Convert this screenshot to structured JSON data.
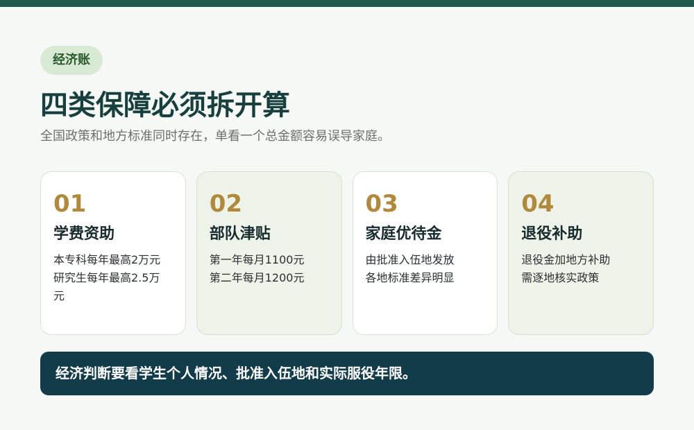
{
  "header": {
    "pill": "经济账",
    "title": "四类保障必须拆开算",
    "subtitle": "全国政策和地方标准同时存在，单看一个总金额容易误导家庭。"
  },
  "cards": [
    {
      "num": "01",
      "title": "学费资助",
      "lines": [
        "本专科每年最高2万元",
        "研究生每年最高2.5万",
        "元"
      ]
    },
    {
      "num": "02",
      "title": "部队津贴",
      "lines": [
        "第一年每月1100元",
        "第二年每月1200元"
      ]
    },
    {
      "num": "03",
      "title": "家庭优待金",
      "lines": [
        "由批准入伍地发放",
        "各地标准差异明显"
      ]
    },
    {
      "num": "04",
      "title": "退役补助",
      "lines": [
        "退役金加地方补助",
        "需逐地核实政策"
      ]
    }
  ],
  "footer": {
    "text": "经济判断要看学生个人情况、批准入伍地和实际服役年限。"
  },
  "colors": {
    "topbar": "#1f5a4c",
    "pill_bg": "#d8ead3",
    "accent_number": "#b08a3a",
    "footer_bg": "#123c49"
  }
}
